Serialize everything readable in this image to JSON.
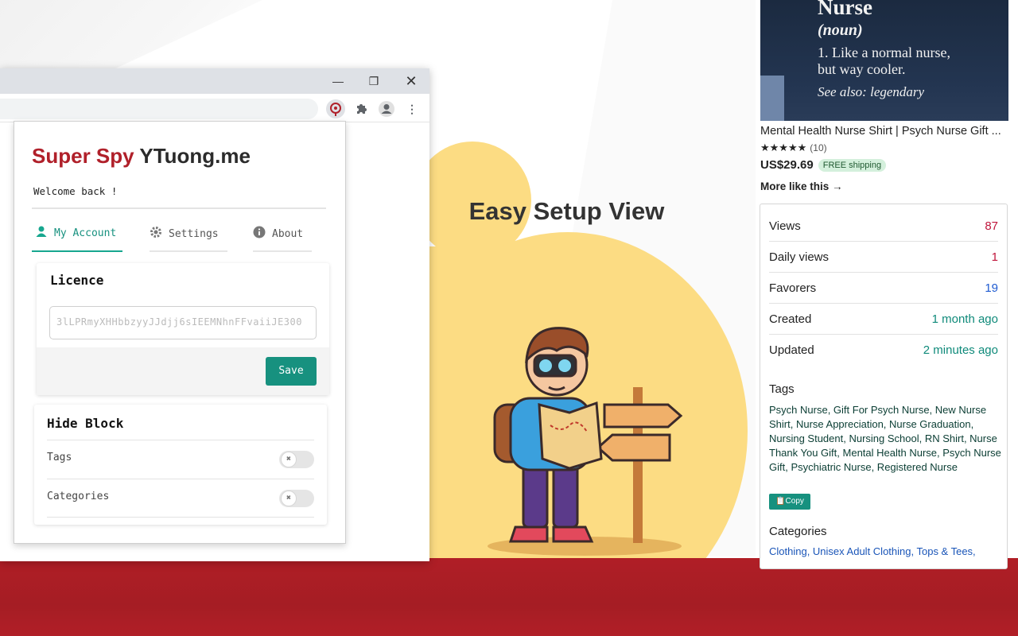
{
  "headline": "Easy Setup View",
  "popup": {
    "brand_red": "Super Spy",
    "brand_dark": "YTuong.me",
    "welcome": "Welcome back !",
    "tabs": [
      {
        "label": "My Account",
        "icon": "person-icon",
        "active": true
      },
      {
        "label": "Settings",
        "icon": "gear-icon",
        "active": false
      },
      {
        "label": "About",
        "icon": "info-icon",
        "active": false
      }
    ],
    "licence": {
      "title": "Licence",
      "value": "3lLPRmyXHHbbzyyJJdjj6sIEEMNhnFFvaiiJE300",
      "save_label": "Save"
    },
    "hide_block": {
      "title": "Hide Block",
      "rows": [
        {
          "label": "Tags",
          "enabled": false
        },
        {
          "label": "Categories",
          "enabled": false
        }
      ]
    }
  },
  "product": {
    "shirt_lines": [
      "Nurse",
      "(noun)",
      "1. Like a normal nurse,",
      "but way cooler.",
      "See also: legendary"
    ],
    "title": "Mental Health Nurse Shirt | Psych Nurse Gift ...",
    "stars": "★★★★★",
    "review_count": "(10)",
    "price": "US$29.69",
    "shipping": "FREE shipping",
    "more_like": "More like this"
  },
  "stats": {
    "rows": [
      {
        "label": "Views",
        "value": "87",
        "color": "#c0163c"
      },
      {
        "label": "Daily views",
        "value": "1",
        "color": "#c0163c"
      },
      {
        "label": "Favorers",
        "value": "19",
        "color": "#1f5bd1"
      },
      {
        "label": "Created",
        "value": "1 month ago",
        "color": "#0f8a7a"
      },
      {
        "label": "Updated",
        "value": "2 minutes ago",
        "color": "#0f8a7a"
      }
    ],
    "tags_title": "Tags",
    "tags": "Psych Nurse, Gift For Psych Nurse, New Nurse Shirt, Nurse Appreciation, Nurse Graduation, Nursing Student, Nursing School, RN Shirt, Nurse Thank You Gift, Mental Health Nurse, Psych Nurse Gift, Psychiatric Nurse, Registered Nurse",
    "copy_label": "Copy",
    "categories_title": "Categories",
    "categories": "Clothing, Unisex Adult Clothing, Tops & Tees,"
  },
  "colors": {
    "brand_red": "#b0202a",
    "accent_teal": "#17917f",
    "blob_yellow": "#fcdc83",
    "band_red": "#a51d24"
  }
}
